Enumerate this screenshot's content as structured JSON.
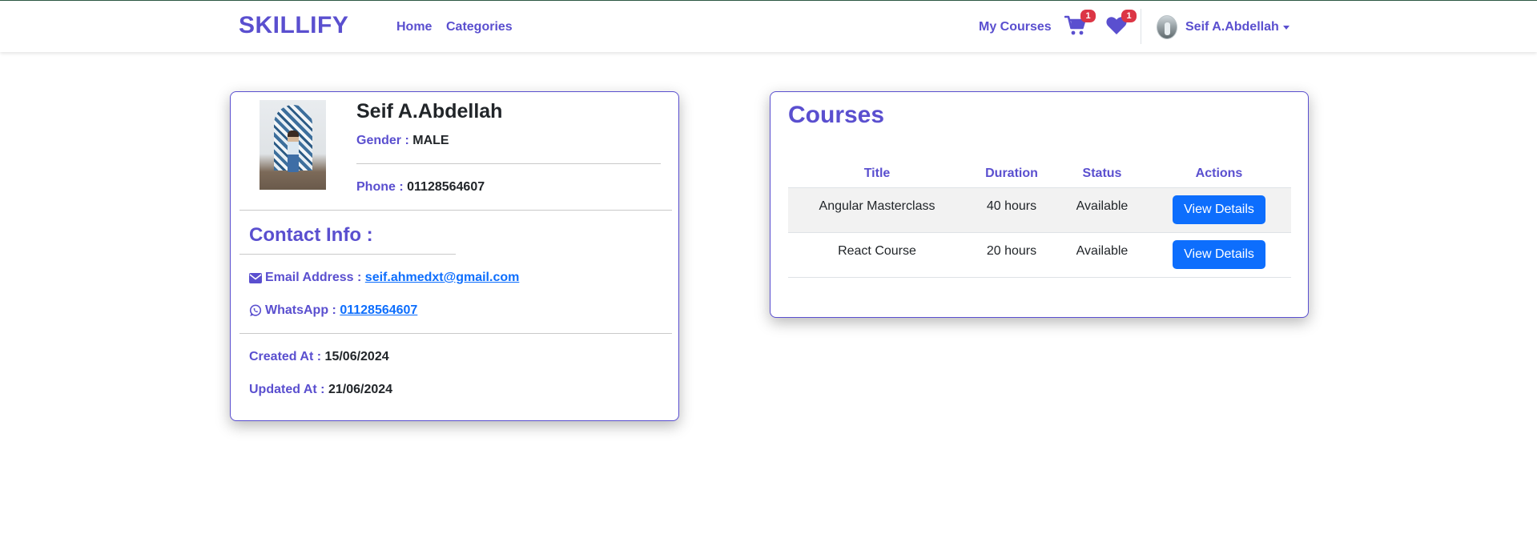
{
  "navbar": {
    "brand": "SKILLIFY",
    "links": {
      "home": "Home",
      "categories": "Categories",
      "my_courses": "My Courses"
    },
    "cart_badge": "1",
    "wishlist_badge": "1",
    "user_name": "Seif A.Abdellah"
  },
  "profile": {
    "name": "Seif A.Abdellah",
    "gender_label": "Gender :",
    "gender": "MALE",
    "phone_label": "Phone :",
    "phone": "01128564607",
    "contact_title": "Contact Info :",
    "email_label": "Email Address :",
    "email": "seif.ahmedxt@gmail.com",
    "whatsapp_label": "WhatsApp :",
    "whatsapp": "01128564607",
    "created_label": "Created At :",
    "created": "15/06/2024",
    "updated_label": "Updated At :",
    "updated": "21/06/2024"
  },
  "courses": {
    "title": "Courses",
    "columns": [
      "Title",
      "Duration",
      "Status",
      "Actions"
    ],
    "rows": [
      {
        "title": "Angular Masterclass",
        "duration": "40 hours",
        "status": "Available",
        "action": "View Details"
      },
      {
        "title": "React Course",
        "duration": "20 hours",
        "status": "Available",
        "action": "View Details"
      }
    ]
  },
  "colors": {
    "accent": "#5a4fcf",
    "button": "#0d6efd",
    "badge": "#dc3545"
  },
  "icons": {
    "cart": "cart-icon",
    "wishlist": "heart-icon",
    "email": "envelope-icon",
    "whatsapp": "whatsapp-icon"
  }
}
